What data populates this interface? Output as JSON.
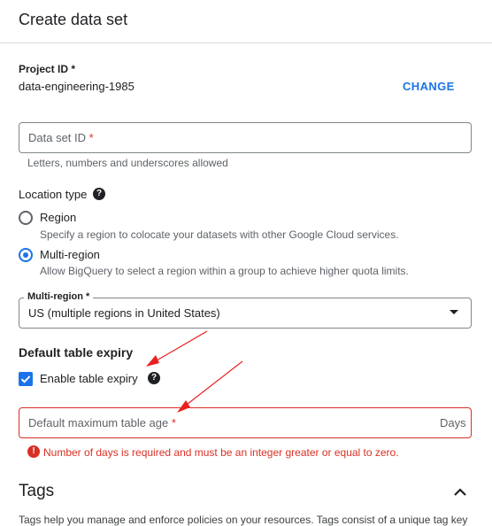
{
  "header": {
    "title": "Create data set"
  },
  "project": {
    "label": "Project ID",
    "required_mark": "*",
    "value": "data-engineering-1985",
    "change_label": "CHANGE"
  },
  "dataset_id": {
    "placeholder": "Data set ID",
    "required_mark": "*",
    "hint": "Letters, numbers and underscores allowed"
  },
  "location": {
    "label": "Location type",
    "help_icon": "help-circle-icon",
    "options": [
      {
        "label": "Region",
        "desc": "Specify a region to colocate your datasets with other Google Cloud services.",
        "selected": false
      },
      {
        "label": "Multi-region",
        "desc": "Allow BigQuery to select a region within a group to achieve higher quota limits.",
        "selected": true
      }
    ]
  },
  "multi_region": {
    "label": "Multi-region",
    "required_mark": "*",
    "value": "US (multiple regions in United States)"
  },
  "expiry": {
    "section_title": "Default table expiry",
    "checkbox_label": "Enable table expiry",
    "checked": true,
    "age_placeholder": "Default maximum table age",
    "age_required_mark": "*",
    "age_suffix": "Days",
    "error": "Number of days is required and must be an integer greater or equal to zero."
  },
  "tags": {
    "title": "Tags",
    "desc": "Tags help you manage and enforce policies on your resources. Tags consist of a unique tag key"
  },
  "colors": {
    "accent": "#1a73e8",
    "error": "#d93025",
    "annotation": "#e8201f"
  }
}
